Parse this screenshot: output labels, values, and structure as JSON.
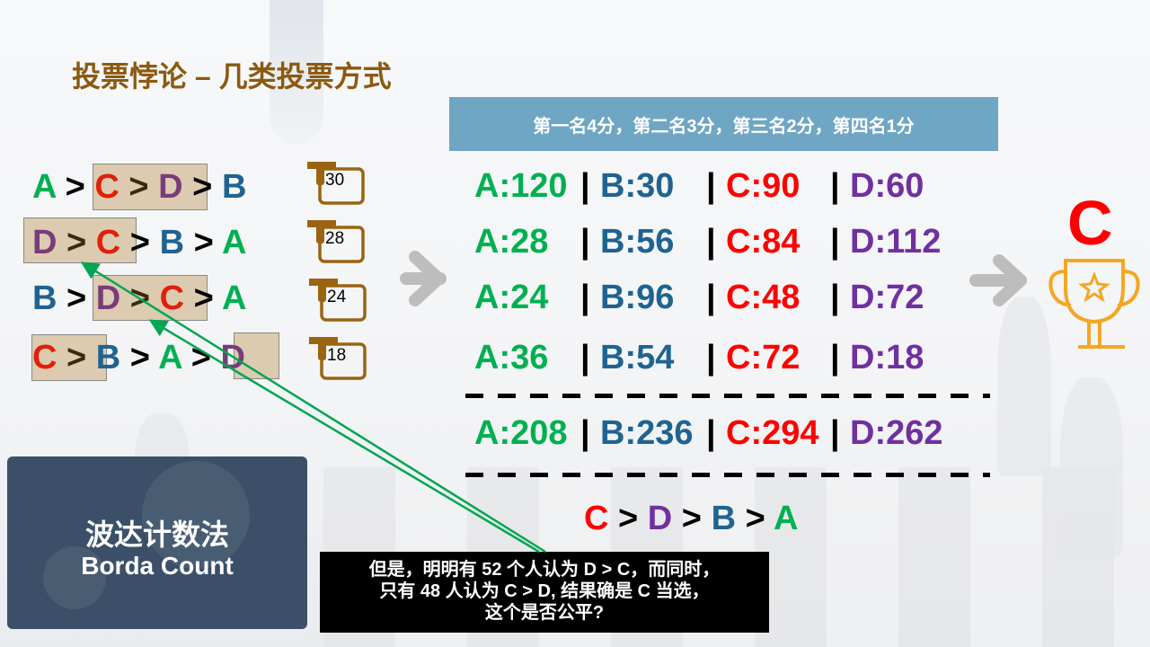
{
  "title": "投票悖论 – 几类投票方式",
  "banner": "第一名4分，第二名3分，第三名2分，第四名1分",
  "rankings": [
    {
      "order": [
        "A",
        "C",
        "D",
        "B"
      ],
      "votes": "30"
    },
    {
      "order": [
        "D",
        "C",
        "B",
        "A"
      ],
      "votes": "28"
    },
    {
      "order": [
        "B",
        "D",
        "C",
        "A"
      ],
      "votes": "24"
    },
    {
      "order": [
        "C",
        "B",
        "A",
        "D"
      ],
      "votes": "18"
    }
  ],
  "separator": ">",
  "scores": [
    [
      "A:120",
      "B:30",
      "C:90",
      "D:60"
    ],
    [
      "A:28",
      "B:56",
      "C:84",
      "D:112"
    ],
    [
      "A:24",
      "B:96",
      "C:48",
      "D:72"
    ],
    [
      "A:36",
      "B:54",
      "C:72",
      "D:18"
    ]
  ],
  "totals": [
    "A:208",
    "B:236",
    "C:294",
    "D:262"
  ],
  "column_divider": "|",
  "result": [
    "C",
    "D",
    "B",
    "A"
  ],
  "winner": "C",
  "method": {
    "zh": "波达计数法",
    "en": "Borda Count"
  },
  "note": [
    "但是，明明有 52 个人认为 D > C，而同时，",
    "只有 48 人认为 C > D, 结果确是 C 当选，",
    "这个是否公平?"
  ],
  "colors": {
    "A": "#00b050",
    "B": "#1f6390",
    "C": "#ff0000",
    "D": "#7030a0",
    "title": "#8b5a10",
    "banner": "#6fa6c3",
    "arrow": "#00a651"
  },
  "icons": [
    "ballot-box-icon",
    "right-arrow-icon",
    "trophy-icon"
  ]
}
